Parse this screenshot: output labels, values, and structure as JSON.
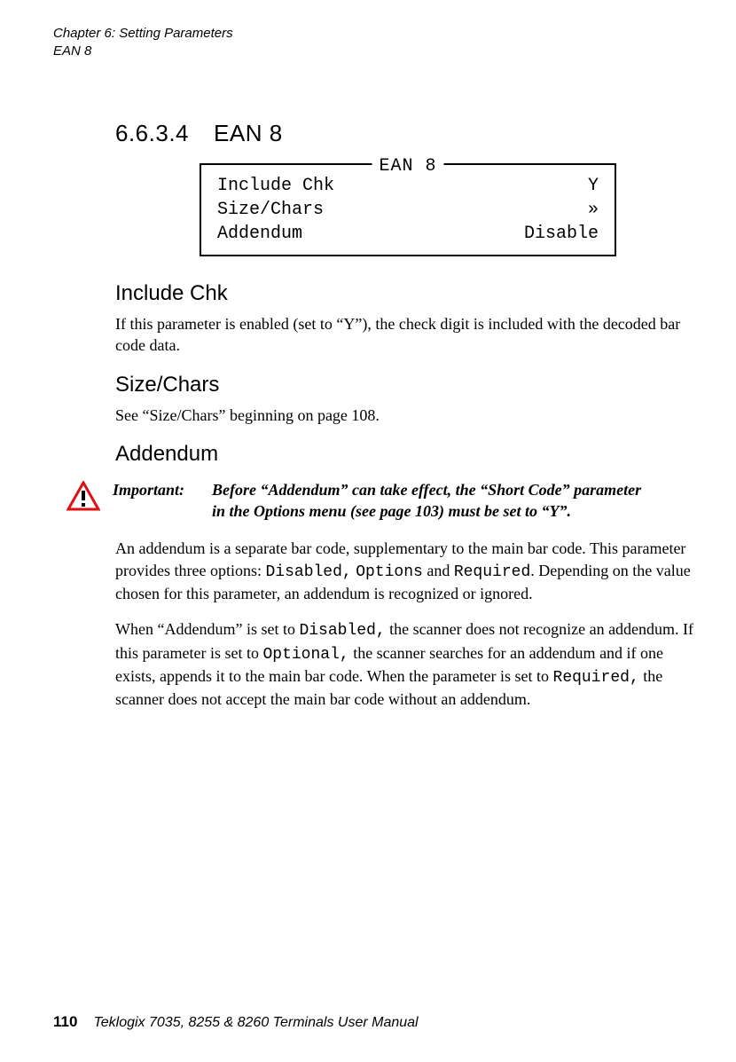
{
  "header": {
    "chapter_line": "Chapter  6:  Setting Parameters",
    "subject_line": "EAN 8"
  },
  "section": {
    "number": "6.6.3.4",
    "title": "EAN 8"
  },
  "ean_box": {
    "legend": "EAN 8",
    "rows": [
      {
        "label": "Include Chk",
        "value": "Y"
      },
      {
        "label": "Size/Chars",
        "value": "»"
      },
      {
        "label": "Addendum",
        "value": "Disable"
      }
    ]
  },
  "include_chk": {
    "heading": "Include Chk",
    "text": "If this parameter is enabled (set to “Y”), the check digit is included with the decoded bar code data."
  },
  "size_chars": {
    "heading": "Size/Chars",
    "text": "See “Size/Chars” beginning on page 108."
  },
  "addendum": {
    "heading": "Addendum",
    "important_label": "Important:",
    "important_msg_line1": "Before “Addendum” can take effect, the “Short Code” parameter",
    "important_msg_line2": "in the Options menu (see page 103) must be set to “Y”.",
    "p1_a": "An addendum is a separate bar code, supplementary to the main bar code. This parameter provides three options: ",
    "p1_code1": "Disabled,",
    "p1_mid": " ",
    "p1_code2": "Options",
    "p1_b": " and ",
    "p1_code3": "Required",
    "p1_c": ". Depending on the value chosen for this parameter, an addendum is recognized or ignored.",
    "p2_a": "When “Addendum” is set to ",
    "p2_code1": "Disabled,",
    "p2_b": " the scanner does not recognize an addendum. If this parameter is set to ",
    "p2_code2": "Optional,",
    "p2_c": " the scanner searches for an addendum and if one exists, appends it to the main bar code. When the parameter is set to ",
    "p2_code3": "Required,",
    "p2_d": " the scanner does not accept the main bar code without an addendum."
  },
  "footer": {
    "page_number": "110",
    "manual_title": "Teklogix 7035, 8255 & 8260 Terminals User Manual"
  }
}
